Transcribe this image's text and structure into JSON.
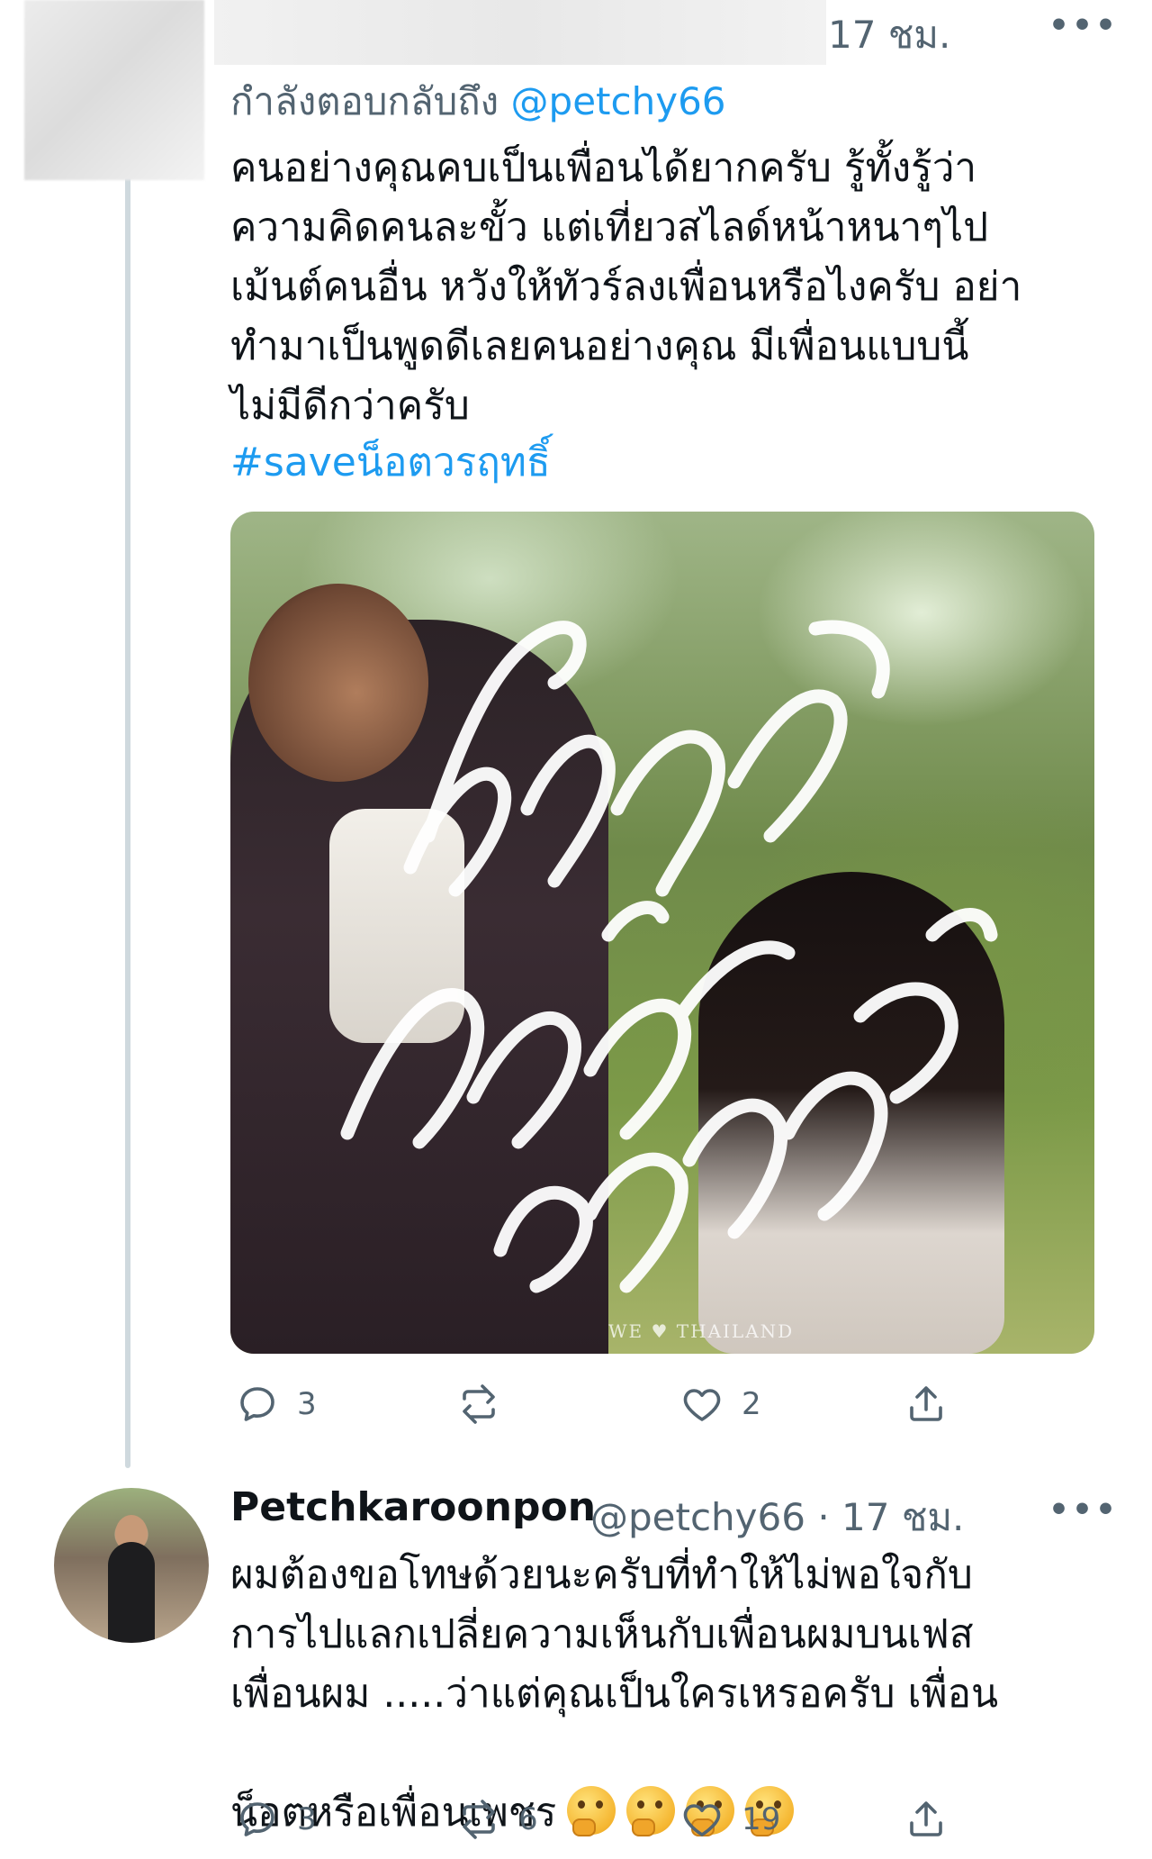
{
  "tweet1": {
    "time": "17 ชม.",
    "more": "•••",
    "reply_prefix": "กำลังตอบกลับถึง",
    "reply_handle": "@petchy66",
    "text": "คนอย่างคุณคบเป็นเพื่อนได้ยากครับ รู้ทั้งรู้ว่า\nความคิดคนละขั้ว แต่เที่ยวสไลด์หน้าหนาๆไป\nเม้นต์คนอื่น หวังให้ทัวร์ลงเพื่อนหรือไงครับ อย่า\nทำมาเป็นพูดดีเลยคนอย่างคุณ มีเพื่อนแบบนี้\nไม่มีดีกว่าครับ",
    "hashtag": "#saveน็อตวรฤทธิ์",
    "media": {
      "calligraphy": "รักชาติ ศาสน์ กษัตริย์",
      "watermark": "WE ♥ THAILAND"
    },
    "actions": {
      "reply_count": "3",
      "retweet_count": "",
      "like_count": "2"
    }
  },
  "tweet2": {
    "name": "Petchkaroonpon",
    "handle": "@petchy66",
    "time": "· 17 ชม.",
    "more": "•••",
    "text": "ผมต้องขอโทษด้วยนะครับที่ทำให้ไม่พอใจกับ\nการไปแลกเปลี่ยความเห็นกับเพื่อนผมบนเฟส\nเพื่อนผม .....ว่าแต่คุณเป็นใครเหรอครับ เพื่อน",
    "text_last": "น็อตหรือเพื่อนเพชร",
    "emojis": [
      "thinking-face",
      "thinking-face",
      "thinking-face",
      "thinking-face"
    ],
    "actions": {
      "reply_count": "3",
      "retweet_count": "6",
      "like_count": "19"
    }
  },
  "colors": {
    "accent": "#1d9bf0",
    "muted": "#536471",
    "text": "#0f1419",
    "thread_line": "#cfd9de"
  }
}
